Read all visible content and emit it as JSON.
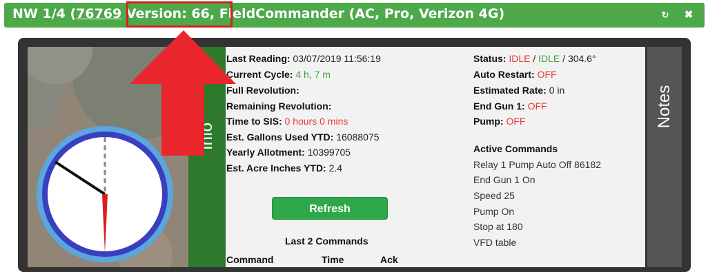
{
  "header": {
    "prefix": "NW 1/4 (",
    "link": "76769",
    "version": " Version: 66,",
    "rest": " FieldCommander (AC, Pro, Verizon 4G)",
    "refresh_icon": "↻",
    "close_icon": "✖"
  },
  "strip_text": "Info",
  "left": [
    {
      "label": "Last Reading:",
      "value": "03/07/2019 11:56:19",
      "color": "default"
    },
    {
      "label": "Current Cycle:",
      "value": "4 h, 7 m",
      "color": "green"
    },
    {
      "label": "Full Revolution:",
      "value": "",
      "color": "default"
    },
    {
      "label": "Remaining Revolution:",
      "value": "",
      "color": "default"
    },
    {
      "label": "Time to SIS:",
      "value": "0 hours 0 mins",
      "color": "red"
    },
    {
      "label": "Est. Gallons Used YTD:",
      "value": "16088075",
      "color": "default"
    },
    {
      "label": "Yearly Allotment:",
      "value": "10399705",
      "color": "default"
    },
    {
      "label": "Est. Acre Inches YTD:",
      "value": "2.4",
      "color": "default"
    }
  ],
  "status": {
    "label": "Status:",
    "v1": "IDLE",
    "sep1": " / ",
    "v2": "IDLE",
    "sep2": " / ",
    "v3": "304.6°"
  },
  "right": [
    {
      "label": "Auto Restart:",
      "value": "OFF",
      "color": "red"
    },
    {
      "label": "Estimated Rate:",
      "value": "0 in",
      "color": "default"
    },
    {
      "label": "End Gun 1:",
      "value": "OFF",
      "color": "red"
    },
    {
      "label": "Pump:",
      "value": "OFF",
      "color": "red"
    }
  ],
  "active_commands": {
    "title": "Active Commands",
    "items": [
      "Relay 1 Pump Auto Off 86182",
      "End Gun 1 On",
      "Speed 25",
      "Pump On",
      "Stop at 180",
      "VFD table"
    ]
  },
  "refresh_label": "Refresh",
  "last_commands": {
    "title": "Last 2 Commands",
    "columns": [
      "Command",
      "Time",
      "Ack"
    ]
  },
  "notes_label": "Notes",
  "colors": {
    "header": "#4ea94a",
    "highlight": "#d62020",
    "arrow": "#e8262b",
    "button": "#2ea84a"
  }
}
